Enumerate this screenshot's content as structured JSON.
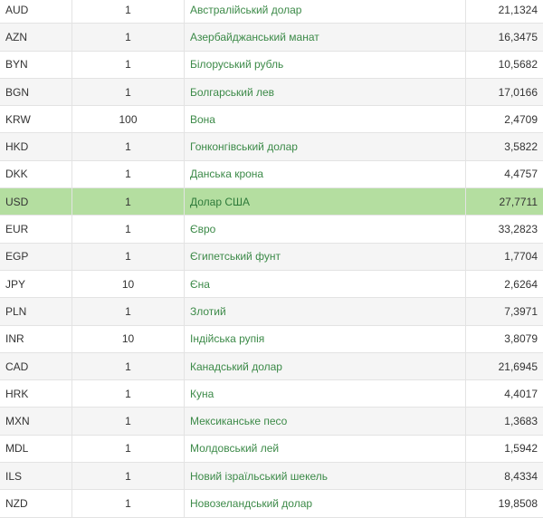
{
  "rates": {
    "rows": [
      {
        "code": "AUD",
        "units": "1",
        "name": "Австралійський долар",
        "rate": "21,1324"
      },
      {
        "code": "AZN",
        "units": "1",
        "name": "Азербайджанський манат",
        "rate": "16,3475"
      },
      {
        "code": "BYN",
        "units": "1",
        "name": "Білоруський рубль",
        "rate": "10,5682"
      },
      {
        "code": "BGN",
        "units": "1",
        "name": "Болгарський лев",
        "rate": "17,0166"
      },
      {
        "code": "KRW",
        "units": "100",
        "name": "Вона",
        "rate": "2,4709"
      },
      {
        "code": "HKD",
        "units": "1",
        "name": "Гонконгівський долар",
        "rate": "3,5822"
      },
      {
        "code": "DKK",
        "units": "1",
        "name": "Данська крона",
        "rate": "4,4757"
      },
      {
        "code": "USD",
        "units": "1",
        "name": "Долар США",
        "rate": "27,7711",
        "highlighted": true
      },
      {
        "code": "EUR",
        "units": "1",
        "name": "Євро",
        "rate": "33,2823"
      },
      {
        "code": "EGP",
        "units": "1",
        "name": "Єгипетський фунт",
        "rate": "1,7704"
      },
      {
        "code": "JPY",
        "units": "10",
        "name": "Єна",
        "rate": "2,6264"
      },
      {
        "code": "PLN",
        "units": "1",
        "name": "Злотий",
        "rate": "7,3971"
      },
      {
        "code": "INR",
        "units": "10",
        "name": "Індійська рупія",
        "rate": "3,8079"
      },
      {
        "code": "CAD",
        "units": "1",
        "name": "Канадський долар",
        "rate": "21,6945"
      },
      {
        "code": "HRK",
        "units": "1",
        "name": "Куна",
        "rate": "4,4017"
      },
      {
        "code": "MXN",
        "units": "1",
        "name": "Мексиканське песо",
        "rate": "1,3683"
      },
      {
        "code": "MDL",
        "units": "1",
        "name": "Молдовський лей",
        "rate": "1,5942"
      },
      {
        "code": "ILS",
        "units": "1",
        "name": "Новий ізраїльський шекель",
        "rate": "8,4334"
      },
      {
        "code": "NZD",
        "units": "1",
        "name": "Новозеландський долар",
        "rate": "19,8508"
      }
    ]
  },
  "colors": {
    "highlight": "#b4dea0",
    "link": "#3c8a48",
    "alt_row": "#f5f5f5"
  }
}
